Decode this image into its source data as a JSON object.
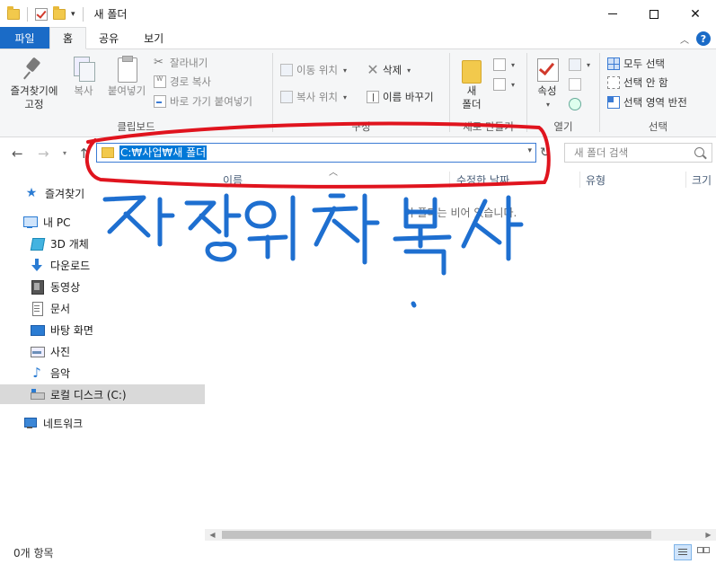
{
  "titlebar": {
    "title": "새 폴더",
    "dropdown_glyph": "▾"
  },
  "tabs": {
    "file": "파일",
    "items": [
      "홈",
      "공유",
      "보기"
    ],
    "active": "홈",
    "help": "?"
  },
  "ribbon": {
    "clipboard": {
      "pin": "즐겨찾기에 고정",
      "pin_line1": "즐겨찾기에",
      "pin_line2": "고정",
      "copy": "복사",
      "paste": "붙여넣기",
      "cut": "잘라내기",
      "copy_path": "경로 복사",
      "paste_shortcut": "바로 가기 붙여넣기",
      "label": "클립보드"
    },
    "organize": {
      "move_to": "이동 위치",
      "copy_to": "복사 위치",
      "delete": "삭제",
      "rename": "이름 바꾸기",
      "label": "구성"
    },
    "new": {
      "new_folder_line1": "새",
      "new_folder_line2": "폴더",
      "label": "새로 만들기"
    },
    "open": {
      "properties": "속성",
      "label": "열기"
    },
    "select": {
      "select_all": "모두 선택",
      "select_none": "선택 안 함",
      "invert": "선택 영역 반전",
      "label": "선택"
    }
  },
  "address": {
    "path": "C:₩사업₩새 폴더",
    "search_placeholder": "새 폴더 검색"
  },
  "sidebar": {
    "items": [
      {
        "label": "즐겨찾기",
        "icon": "star-icon"
      },
      {
        "label": "내 PC",
        "icon": "pc-icon"
      },
      {
        "label": "3D 개체",
        "icon": "objects3d-icon"
      },
      {
        "label": "다운로드",
        "icon": "download-icon"
      },
      {
        "label": "동영상",
        "icon": "video-icon"
      },
      {
        "label": "문서",
        "icon": "document-icon"
      },
      {
        "label": "바탕 화면",
        "icon": "desktop-icon"
      },
      {
        "label": "사진",
        "icon": "picture-icon"
      },
      {
        "label": "음악",
        "icon": "music-icon"
      },
      {
        "label": "로컬 디스크 (C:)",
        "icon": "disk-icon",
        "selected": true
      },
      {
        "label": "네트워크",
        "icon": "network-icon"
      }
    ]
  },
  "content": {
    "columns": [
      "이름",
      "수정한 날짜",
      "유형",
      "크기"
    ],
    "empty_message": "이 폴더는 비어 있습니다."
  },
  "status": {
    "item_count": "0개 항목"
  },
  "annotation": {
    "handwriting": "저장위치 복사",
    "color": "#1e6fd0",
    "highlight_color": "#e0141e"
  }
}
